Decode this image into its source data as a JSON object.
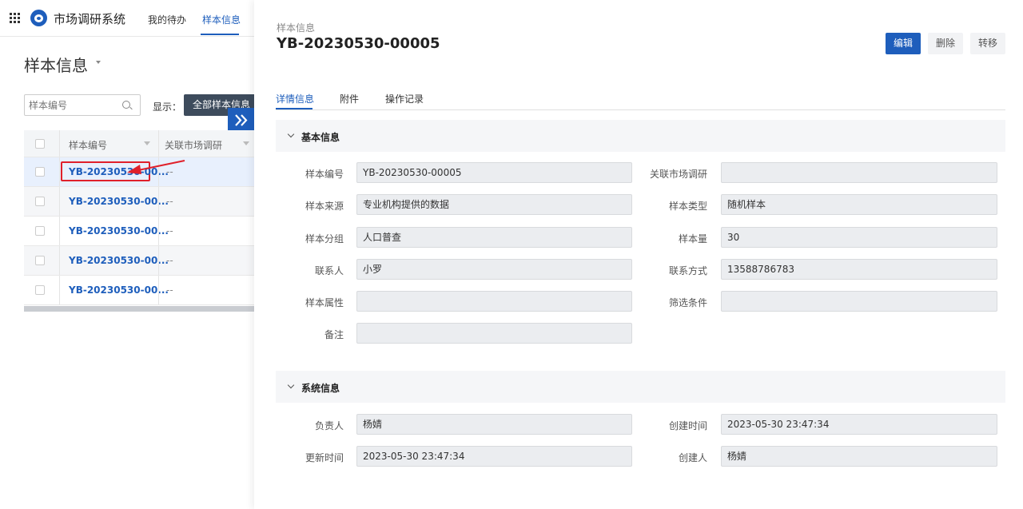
{
  "app": {
    "title": "市场调研系统"
  },
  "nav": {
    "tabs": [
      {
        "label": "我的待办"
      },
      {
        "label": "样本信息",
        "active": true
      }
    ]
  },
  "list": {
    "page_title": "样本信息",
    "search_placeholder": "样本编号",
    "show_label": "显示：",
    "show_value": "全部样本信息",
    "columns": [
      "样本编号",
      "关联市场调研"
    ],
    "rows": [
      {
        "id": "YB-20230530-00...",
        "related": "--",
        "selected": true,
        "highlighted": true
      },
      {
        "id": "YB-20230530-00...",
        "related": "--"
      },
      {
        "id": "YB-20230530-00...",
        "related": "--"
      },
      {
        "id": "YB-20230530-00...",
        "related": "--"
      },
      {
        "id": "YB-20230530-00...",
        "related": "--"
      }
    ]
  },
  "detail": {
    "breadcrumb": "样本信息",
    "title": "YB-20230530-00005",
    "actions": {
      "edit": "编辑",
      "delete": "删除",
      "transfer": "转移"
    },
    "tabs": [
      {
        "label": "详情信息",
        "active": true
      },
      {
        "label": "附件"
      },
      {
        "label": "操作记录"
      }
    ],
    "basic": {
      "title": "基本信息",
      "fields": {
        "sample_no": {
          "label": "样本编号",
          "value": "YB-20230530-00005"
        },
        "related_survey": {
          "label": "关联市场调研",
          "value": ""
        },
        "source": {
          "label": "样本来源",
          "value": "专业机构提供的数据"
        },
        "type": {
          "label": "样本类型",
          "value": "随机样本"
        },
        "group": {
          "label": "样本分组",
          "value": "人口普查"
        },
        "size": {
          "label": "样本量",
          "value": "30"
        },
        "contact": {
          "label": "联系人",
          "value": "小罗"
        },
        "phone": {
          "label": "联系方式",
          "value": "13588786783"
        },
        "attribute": {
          "label": "样本属性",
          "value": ""
        },
        "filter": {
          "label": "筛选条件",
          "value": ""
        },
        "remark": {
          "label": "备注",
          "value": ""
        }
      }
    },
    "system": {
      "title": "系统信息",
      "fields": {
        "owner": {
          "label": "负责人",
          "value": "杨婧"
        },
        "created_at": {
          "label": "创建时间",
          "value": "2023-05-30 23:47:34"
        },
        "updated_at": {
          "label": "更新时间",
          "value": "2023-05-30 23:47:34"
        },
        "creator": {
          "label": "创建人",
          "value": "杨婧"
        }
      }
    }
  },
  "colors": {
    "primary": "#1e5ebc",
    "dark_select": "#3d4b5c",
    "highlight": "#e0202a"
  }
}
